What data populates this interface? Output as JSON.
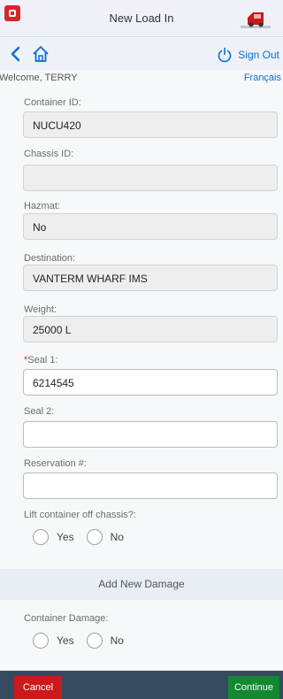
{
  "header": {
    "title": "New Load In",
    "logo_icon": "app-logo-icon",
    "truck_icon": "truck-icon"
  },
  "nav": {
    "back_icon": "chevron-left-icon",
    "home_icon": "home-icon",
    "signout_label": "Sign Out",
    "signout_icon": "power-icon"
  },
  "welcome": {
    "text": "Welcome, TERRY",
    "language": "Français"
  },
  "form": {
    "container_id": {
      "label": "Container ID:",
      "value": "NUCU420"
    },
    "chassis_id": {
      "label": "Chassis ID:",
      "value": ""
    },
    "hazmat": {
      "label": "Hazmat:",
      "value": "No"
    },
    "destination": {
      "label": "Destination:",
      "value": "VANTERM WHARF IMS"
    },
    "weight": {
      "label": "Weight:",
      "value": "25000 L"
    },
    "seal1": {
      "required_mark": "*",
      "label": "Seal 1:",
      "value": "6214545"
    },
    "seal2": {
      "label": "Seal 2:",
      "value": ""
    },
    "reservation": {
      "label": "Reservation #:",
      "value": ""
    },
    "lift_container": {
      "label": "Lift container off chassis?:",
      "yes": "Yes",
      "no": "No"
    },
    "add_damage": "Add New Damage",
    "container_damage": {
      "label": "Container Damage:",
      "yes": "Yes",
      "no": "No"
    }
  },
  "footer": {
    "cancel": "Cancel",
    "continue": "Continue"
  },
  "colors": {
    "accent_blue": "#0a6ed1",
    "cancel_red": "#cc1919",
    "continue_green": "#128830",
    "footer_bg": "#354a5f"
  }
}
